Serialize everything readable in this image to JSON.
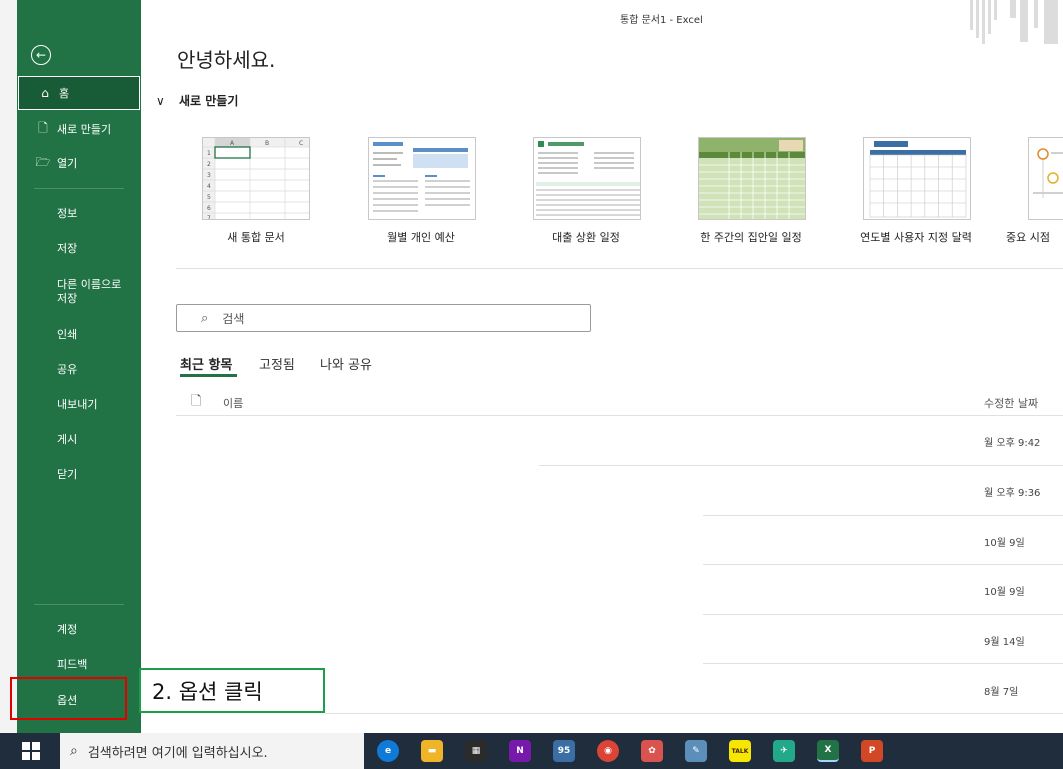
{
  "window": {
    "title": "통합 문서1  -  Excel"
  },
  "sidebar": {
    "back_label": "←",
    "top_items": [
      {
        "label": "홈",
        "icon": "home-icon",
        "glyph": "⌂"
      },
      {
        "label": "새로 만들기",
        "icon": "new-document-icon",
        "glyph": "🗋"
      },
      {
        "label": "열기",
        "icon": "folder-open-icon",
        "glyph": "🗁"
      }
    ],
    "items": [
      "정보",
      "저장",
      "다른 이름으로\n저장",
      "인쇄",
      "공유",
      "내보내기",
      "게시",
      "닫기"
    ],
    "bottom_items": [
      "계정",
      "피드백",
      "옵션"
    ]
  },
  "main": {
    "greeting": "안녕하세요.",
    "new_section": {
      "chevron": "∨",
      "title": "새로 만들기"
    },
    "templates": [
      {
        "label": "새 통합 문서"
      },
      {
        "label": "월별 개인 예산"
      },
      {
        "label": "대출 상환 일정"
      },
      {
        "label": "한 주간의 집안일 일정"
      },
      {
        "label": "연도별 사용자 지정 달력"
      },
      {
        "label": "중요 시점"
      }
    ],
    "search": {
      "placeholder": "검색",
      "icon": "search-icon"
    },
    "tabs": [
      "최근 항목",
      "고정됨",
      "나와 공유"
    ],
    "columns": {
      "name": "이름",
      "modified": "수정한 날짜"
    },
    "recent_dates": [
      "월 오후 9:42",
      "월 오후 9:36",
      "10월 9일",
      "10월 9일",
      "9월 14일",
      "8월 7일"
    ]
  },
  "annotation": {
    "text": "2. 옵션 클릭",
    "highlight_color": "#e00000",
    "callout_color": "#1a9e4a"
  },
  "taskbar": {
    "search_placeholder": "검색하려면 여기에 입력하십시오.",
    "icons": [
      {
        "name": "edge-icon",
        "color": "#0f7ad8",
        "text": "e"
      },
      {
        "name": "file-explorer-icon",
        "color": "#f0b429",
        "text": "▬"
      },
      {
        "name": "microsoft-store-icon",
        "color": "#2b2b2b",
        "text": "▦"
      },
      {
        "name": "onenote-icon",
        "color": "#7719aa",
        "text": "N"
      },
      {
        "name": "mail-icon",
        "color": "#3a6ea5",
        "text": "95"
      },
      {
        "name": "chrome-icon",
        "color": "#db4437",
        "text": "◉"
      },
      {
        "name": "paint-icon",
        "color": "#d9534f",
        "text": "✿"
      },
      {
        "name": "photo-icon",
        "color": "#5b8fb9",
        "text": "✎"
      },
      {
        "name": "kakaotalk-icon",
        "color": "#f7e600",
        "text": "TALK"
      },
      {
        "name": "xmind-icon",
        "color": "#22a98b",
        "text": "✈"
      },
      {
        "name": "excel-icon",
        "color": "#217346",
        "text": "X"
      },
      {
        "name": "powerpoint-icon",
        "color": "#d24726",
        "text": "P"
      }
    ]
  },
  "colors": {
    "excel_green": "#217346",
    "selected_green": "#185c37"
  }
}
